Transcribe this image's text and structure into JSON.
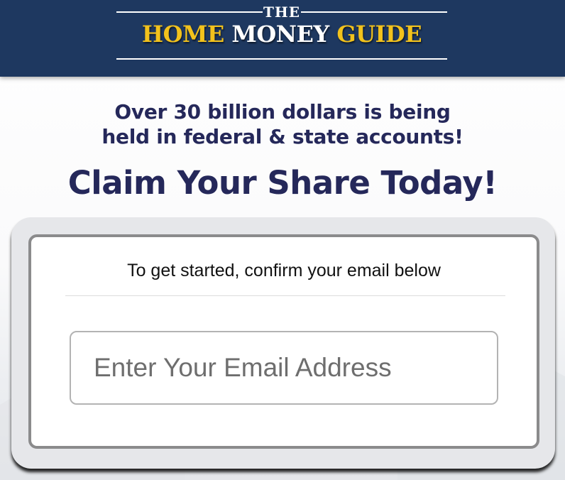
{
  "header": {
    "logo_the": "THE",
    "logo_word1": "HOME",
    "logo_word2": "MONEY",
    "logo_word3": "GUIDE",
    "background_color": "#1e3860",
    "gold_color": "#f2c21c"
  },
  "main": {
    "subhead_line1": "Over 30 billion dollars is being",
    "subhead_line2": "held in federal & state accounts!",
    "headline": "Claim Your Share Today!",
    "text_color": "#25285a"
  },
  "form": {
    "prompt": "To get started, confirm your email below",
    "email_placeholder": "Enter Your Email Address",
    "email_value": ""
  }
}
